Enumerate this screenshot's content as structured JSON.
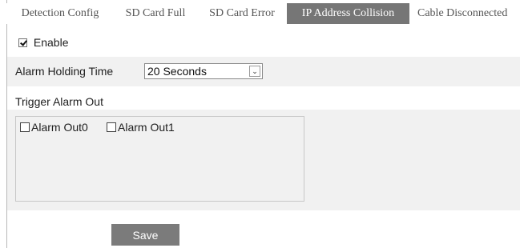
{
  "tabs": [
    {
      "label": "Detection Config",
      "active": false
    },
    {
      "label": "SD Card Full",
      "active": false
    },
    {
      "label": "SD Card Error",
      "active": false
    },
    {
      "label": "IP Address Collision",
      "active": true
    },
    {
      "label": "Cable Disconnected",
      "active": false
    }
  ],
  "enable": {
    "label": "Enable",
    "checked": true
  },
  "alarm_holding": {
    "label": "Alarm Holding Time",
    "value": "20 Seconds"
  },
  "trigger": {
    "label": "Trigger Alarm Out",
    "outputs": [
      {
        "label": "Alarm Out0",
        "checked": false
      },
      {
        "label": "Alarm Out1",
        "checked": false
      }
    ]
  },
  "save_label": "Save",
  "colors": {
    "active_tab": "#767676",
    "panel_bg": "#f1f1f1",
    "button": "#7b7b7b"
  }
}
